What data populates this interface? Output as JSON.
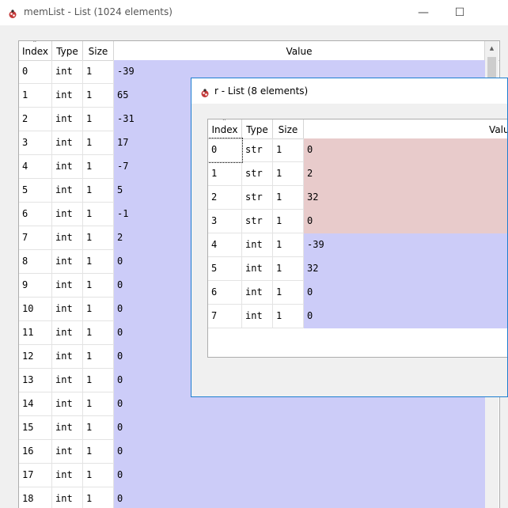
{
  "colors": {
    "int_value_bg": "#ccccf8",
    "str_value_bg": "#e8cbcb"
  },
  "main_window": {
    "title": "memList - List (1024 elements)",
    "icon": "bug-icon",
    "columns": {
      "index": "Index",
      "type": "Type",
      "size": "Size",
      "value": "Value"
    },
    "rows": [
      {
        "index": "0",
        "type": "int",
        "size": "1",
        "value": "-39"
      },
      {
        "index": "1",
        "type": "int",
        "size": "1",
        "value": "65"
      },
      {
        "index": "2",
        "type": "int",
        "size": "1",
        "value": "-31"
      },
      {
        "index": "3",
        "type": "int",
        "size": "1",
        "value": "17"
      },
      {
        "index": "4",
        "type": "int",
        "size": "1",
        "value": "-7"
      },
      {
        "index": "5",
        "type": "int",
        "size": "1",
        "value": "5"
      },
      {
        "index": "6",
        "type": "int",
        "size": "1",
        "value": "-1"
      },
      {
        "index": "7",
        "type": "int",
        "size": "1",
        "value": "2"
      },
      {
        "index": "8",
        "type": "int",
        "size": "1",
        "value": "0"
      },
      {
        "index": "9",
        "type": "int",
        "size": "1",
        "value": "0"
      },
      {
        "index": "10",
        "type": "int",
        "size": "1",
        "value": "0"
      },
      {
        "index": "11",
        "type": "int",
        "size": "1",
        "value": "0"
      },
      {
        "index": "12",
        "type": "int",
        "size": "1",
        "value": "0"
      },
      {
        "index": "13",
        "type": "int",
        "size": "1",
        "value": "0"
      },
      {
        "index": "14",
        "type": "int",
        "size": "1",
        "value": "0"
      },
      {
        "index": "15",
        "type": "int",
        "size": "1",
        "value": "0"
      },
      {
        "index": "16",
        "type": "int",
        "size": "1",
        "value": "0"
      },
      {
        "index": "17",
        "type": "int",
        "size": "1",
        "value": "0"
      },
      {
        "index": "18",
        "type": "int",
        "size": "1",
        "value": "0"
      }
    ]
  },
  "popup_window": {
    "title": "r - List (8 elements)",
    "icon": "bug-icon",
    "columns": {
      "index": "Index",
      "type": "Type",
      "size": "Size",
      "value": "Value"
    },
    "rows": [
      {
        "index": "0",
        "type": "str",
        "size": "1",
        "value": "0"
      },
      {
        "index": "1",
        "type": "str",
        "size": "1",
        "value": "2"
      },
      {
        "index": "2",
        "type": "str",
        "size": "1",
        "value": "32"
      },
      {
        "index": "3",
        "type": "str",
        "size": "1",
        "value": "0"
      },
      {
        "index": "4",
        "type": "int",
        "size": "1",
        "value": "-39"
      },
      {
        "index": "5",
        "type": "int",
        "size": "1",
        "value": "32"
      },
      {
        "index": "6",
        "type": "int",
        "size": "1",
        "value": "0"
      },
      {
        "index": "7",
        "type": "int",
        "size": "1",
        "value": "0"
      }
    ]
  }
}
